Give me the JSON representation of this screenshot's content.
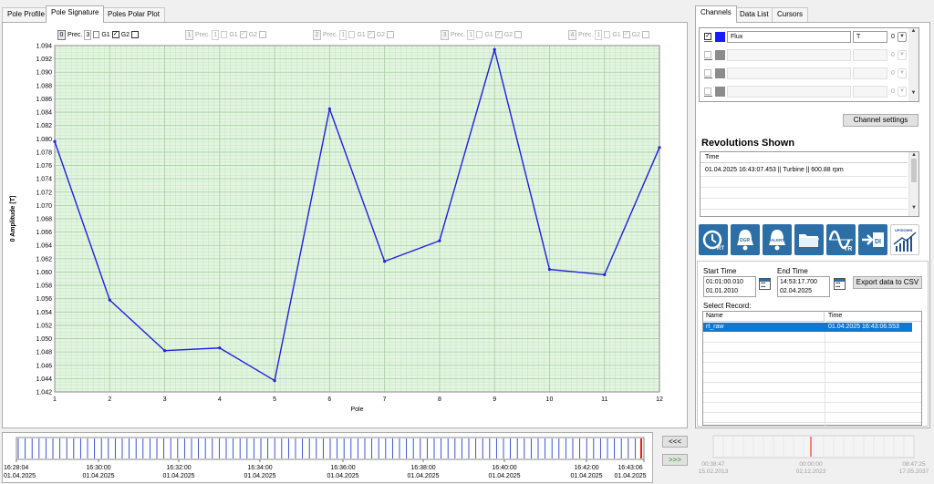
{
  "tabs": [
    "Pole Profile",
    "Pole Signature",
    "Poles Polar Plot"
  ],
  "active_tab": 1,
  "groups": [
    {
      "num": "0",
      "prec_label": "Prec.",
      "prec": "3",
      "g1": "G1",
      "g2": "G2",
      "g1_checked": true,
      "g2_checked": false,
      "enabled": true
    },
    {
      "num": "1",
      "prec_label": "Prec.",
      "prec": "1",
      "g1": "G1",
      "g2": "G2",
      "g1_checked": true,
      "g2_checked": false,
      "enabled": false
    },
    {
      "num": "2",
      "prec_label": "Prec.",
      "prec": "1",
      "g1": "G1",
      "g2": "G2",
      "g1_checked": true,
      "g2_checked": false,
      "enabled": false
    },
    {
      "num": "3",
      "prec_label": "Prec.",
      "prec": "1",
      "g1": "G1",
      "g2": "G2",
      "g1_checked": true,
      "g2_checked": false,
      "enabled": false
    },
    {
      "num": "4",
      "prec_label": "Prec.",
      "prec": "1",
      "g1": "G1",
      "g2": "G2",
      "g1_checked": true,
      "g2_checked": false,
      "enabled": false
    }
  ],
  "chart_data": {
    "type": "line",
    "xlabel": "Pole",
    "ylabel": "0 Amplitude  [T]",
    "x": [
      1,
      2,
      3,
      4,
      5,
      6,
      7,
      8,
      9,
      10,
      11,
      12
    ],
    "series": [
      {
        "values": [
          1.0796,
          1.0558,
          1.0482,
          1.0486,
          1.0437,
          1.0845,
          1.0616,
          1.0647,
          1.0934,
          1.0604,
          1.0596,
          1.0787
        ],
        "color": "#2020e0"
      }
    ],
    "ylim": [
      1.042,
      1.094
    ],
    "yticks": [
      "1.094",
      "1.092",
      "1.090",
      "1.088",
      "1.086",
      "1.084",
      "1.082",
      "1.080",
      "1.078",
      "1.076",
      "1.074",
      "1.072",
      "1.070",
      "1.068",
      "1.066",
      "1.064",
      "1.062",
      "1.060",
      "1.058",
      "1.056",
      "1.054",
      "1.052",
      "1.050",
      "1.048",
      "1.046",
      "1.044",
      "1.042"
    ],
    "xticks": [
      "1",
      "2",
      "3",
      "4",
      "5",
      "6",
      "7",
      "8",
      "9",
      "10",
      "11",
      "12"
    ],
    "grid": true,
    "plot_bg": "#e4f5e2",
    "grid_color": "#a5cfa0"
  },
  "timeline": {
    "ticks": [
      {
        "time": "16:28:04",
        "date": "01.04.2025"
      },
      {
        "time": "16:30:00",
        "date": "01.04.2025"
      },
      {
        "time": "16:32:00",
        "date": "01.04.2025"
      },
      {
        "time": "16:34:00",
        "date": "01.04.2025"
      },
      {
        "time": "16:36:00",
        "date": "01.04.2025"
      },
      {
        "time": "16:38:00",
        "date": "01.04.2025"
      },
      {
        "time": "16:40:00",
        "date": "01.04.2025"
      },
      {
        "time": "16:42:00",
        "date": "01.04.2025"
      },
      {
        "time": "16:43:06",
        "date": "01.04.2025"
      }
    ],
    "back_button": "<<<",
    "forward_button": ">>>"
  },
  "right_tabs": [
    "Channels",
    "Data List",
    "Cursors"
  ],
  "channels": [
    {
      "name": "Flux",
      "unit": "T",
      "index": "0",
      "color": "#1a1aff",
      "checked": true
    },
    {
      "name": "",
      "unit": "",
      "index": "0",
      "color": "#8c8c8c",
      "checked": false
    },
    {
      "name": "",
      "unit": "",
      "index": "0",
      "color": "#8c8c8c",
      "checked": false
    },
    {
      "name": "",
      "unit": "",
      "index": "0",
      "color": "#8c8c8c",
      "checked": false
    }
  ],
  "channel_settings_button": "Channel settings",
  "revolutions": {
    "title": "Revolutions Shown",
    "header": "Time",
    "rows": [
      "01.04.2025 16:43:07.453 || Turbine || 600.88 rpm"
    ]
  },
  "tool_icons": [
    "rt-icon",
    "dgr-alarm-icon",
    "alert-icon",
    "folder-icon",
    "tr-wave-icon",
    "export-di-icon",
    "up-down-chart-icon"
  ],
  "tool_icon_labels": {
    "rt": "RT",
    "dgr": "DGR",
    "alert": "ALERT",
    "tr": "TR",
    "di": "DI",
    "updown": "UP/DOWN"
  },
  "records": {
    "start_label": "Start Time",
    "start_time": "01:01:00.010",
    "start_date": "01.01.2010",
    "end_label": "End Time",
    "end_time": "14:53:17.700",
    "end_date": "02.04.2025",
    "export_button": "Export data to CSV",
    "select_label": "Select Record:",
    "col_name": "Name",
    "col_time": "Time",
    "rows": [
      {
        "name": "rt_raw",
        "time": "01.04.2025 16:43:06.553"
      }
    ]
  },
  "mini_timeline": {
    "left_time": "00:38:47",
    "left_date": "15.02.2013",
    "mid_time": "00:00:00",
    "mid_date": "02.12.2023",
    "right_time": "08:47:25",
    "right_date": "17.05.2037"
  }
}
